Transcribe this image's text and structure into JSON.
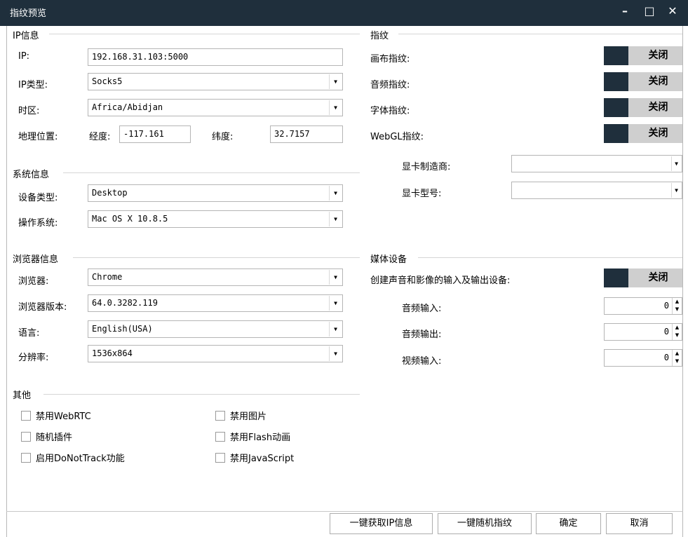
{
  "window": {
    "title": "指纹预览",
    "minimize": "–",
    "maximize": "□",
    "close": "✕"
  },
  "ip_section": {
    "title": "IP信息",
    "ip_label": "IP:",
    "ip_value": "192.168.31.103:5000",
    "ip_type_label": "IP类型:",
    "ip_type_value": "Socks5",
    "timezone_label": "时区:",
    "timezone_value": "Africa/Abidjan",
    "geo_label": "地理位置:",
    "lon_label": "经度:",
    "lon_value": "-117.161",
    "lat_label": "纬度:",
    "lat_value": "32.7157"
  },
  "system_section": {
    "title": "系统信息",
    "device_label": "设备类型:",
    "device_value": "Desktop",
    "os_label": "操作系统:",
    "os_value": "Mac OS X 10.8.5"
  },
  "browser_section": {
    "title": "浏览器信息",
    "browser_label": "浏览器:",
    "browser_value": "Chrome",
    "version_label": "浏览器版本:",
    "version_value": "64.0.3282.119",
    "language_label": "语言:",
    "language_value": "English(USA)",
    "resolution_label": "分辨率:",
    "resolution_value": "1536x864"
  },
  "other_section": {
    "title": "其他",
    "disable_webrtc": "禁用WebRTC",
    "disable_images": "禁用图片",
    "random_plugins": "随机插件",
    "disable_flash": "禁用Flash动画",
    "enable_dnt": "启用DoNotTrack功能",
    "disable_js": "禁用JavaScript"
  },
  "fingerprint_section": {
    "title": "指纹",
    "canvas_label": "画布指纹:",
    "audio_label": "音频指纹:",
    "font_label": "字体指纹:",
    "webgl_label": "WebGL指纹:",
    "toggle_off": "关闭",
    "gpu_vendor_label": "显卡制造商:",
    "gpu_model_label": "显卡型号:"
  },
  "media_section": {
    "title": "媒体设备",
    "create_label": "创建声音和影像的输入及输出设备:",
    "toggle_off": "关闭",
    "audio_in_label": "音频输入:",
    "audio_in_value": "0",
    "audio_out_label": "音频输出:",
    "audio_out_value": "0",
    "video_in_label": "视频输入:",
    "video_in_value": "0"
  },
  "buttons": {
    "get_ip": "一键获取IP信息",
    "random_fp": "一键随机指纹",
    "ok": "确定",
    "cancel": "取消"
  },
  "colors": {
    "titlebar": "#1f2f3c",
    "toggle_dark": "#1f2f3c",
    "toggle_light": "#cfcfcf"
  }
}
